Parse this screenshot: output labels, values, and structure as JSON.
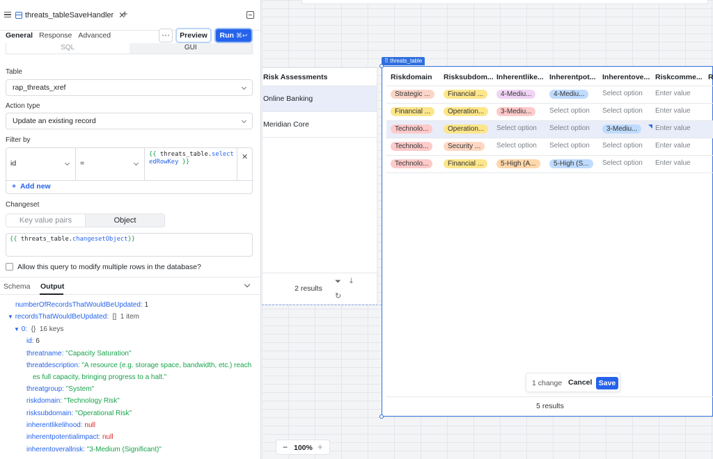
{
  "header": {
    "tab_title": "threats_tableSaveHandler"
  },
  "subtabs": [
    "General",
    "Response",
    "Advanced"
  ],
  "toolbar": {
    "preview_label": "Preview",
    "run_label": "Run",
    "run_shortcut": "⌘↩"
  },
  "mode_segment": {
    "sql": "SQL",
    "gui": "GUI"
  },
  "form": {
    "table_label": "Table",
    "table_value": "rap_threats_xref",
    "action_label": "Action type",
    "action_value": "Update an existing record",
    "filter_label": "Filter by",
    "filter_field": "id",
    "filter_op": "=",
    "filter_code_open": "{{",
    "filter_code_obj": "threats_table.",
    "filter_code_prop": "selectedRowKey",
    "filter_code_close": "}}",
    "add_new": "Add new",
    "changeset_label": "Changeset",
    "changeset_kv": "Key value pairs",
    "changeset_obj": "Object",
    "changeset_code_open": "{{",
    "changeset_code_obj": "threats_table.",
    "changeset_code_prop": "changesetObject",
    "changeset_code_close": "}}",
    "allow_multi": "Allow this query to modify multiple rows in the database?"
  },
  "output_tabs": {
    "schema": "Schema",
    "output": "Output"
  },
  "output": {
    "count_key": "numberOfRecordsThatWouldBeUpdated:",
    "count_val": "1",
    "records_key": "recordsThatWouldBeUpdated:",
    "records_type": "[]",
    "records_meta": "1 item",
    "item_key": "0:",
    "item_type": "{}",
    "item_meta": "16 keys",
    "fields": [
      {
        "k": "id:",
        "v": "6"
      },
      {
        "k": "threatname:",
        "v": "\"Capacity Saturation\""
      },
      {
        "k": "threatdescription:",
        "v": "\"A resource (e.g. storage space, bandwidth, etc.) reach",
        "v2": "es full capacity, bringing progress to a halt.\""
      },
      {
        "k": "threatgroup:",
        "v": "\"System\""
      },
      {
        "k": "riskdomain:",
        "v": "\"Technology Risk\""
      },
      {
        "k": "risksubdomain:",
        "v": "\"Operational Risk\""
      },
      {
        "k": "inherentlikelihood:",
        "v": "null"
      },
      {
        "k": "inherentpotentialimpact:",
        "v": "null"
      },
      {
        "k": "inherentoverallrisk:",
        "v": "\"3-Medium (Significant)\""
      }
    ]
  },
  "risk_table": {
    "header": "Risk Assessments",
    "rows": [
      "Online Banking",
      "Meridian Core"
    ],
    "footer": "2 results"
  },
  "threats_table": {
    "label": "threats_table",
    "columns": [
      "Riskdomain",
      "Risksubdom...",
      "Inherentlike...",
      "Inherentpot...",
      "Inherentove...",
      "Riskcomme...",
      "Re"
    ],
    "placeholder_select": "Select option",
    "placeholder_enter": "Enter value",
    "rows": [
      [
        "Strategic ...",
        "Financial ...",
        "4-Mediu...",
        "4-Mediu...",
        "",
        "",
        ""
      ],
      [
        "Financial ...",
        "Operation...",
        "3-Mediu...",
        "",
        "",
        "",
        ""
      ],
      [
        "Technolo...",
        "Operation...",
        "",
        "",
        "3-Mediu...",
        "",
        ""
      ],
      [
        "Technolo...",
        "Security ...",
        "",
        "",
        "",
        "",
        ""
      ],
      [
        "Technolo...",
        "Financial ...",
        "5-High (A...",
        "5-High (S...",
        "",
        "",
        ""
      ]
    ],
    "change_text": "1 change",
    "cancel": "Cancel",
    "save": "Save",
    "footer": "5 results"
  },
  "zoom": "100%",
  "colors": {
    "accent": "#2563eb",
    "strategic": "#fbd5c8",
    "financial": "#fde68a",
    "technology": "#fecaca",
    "operational": "#fde68a",
    "security": "#fed7c3",
    "medium4": "#f0d4f5",
    "medium3": "#fecaca",
    "high5": "#fed7aa",
    "blue": "#bfdbfe"
  }
}
